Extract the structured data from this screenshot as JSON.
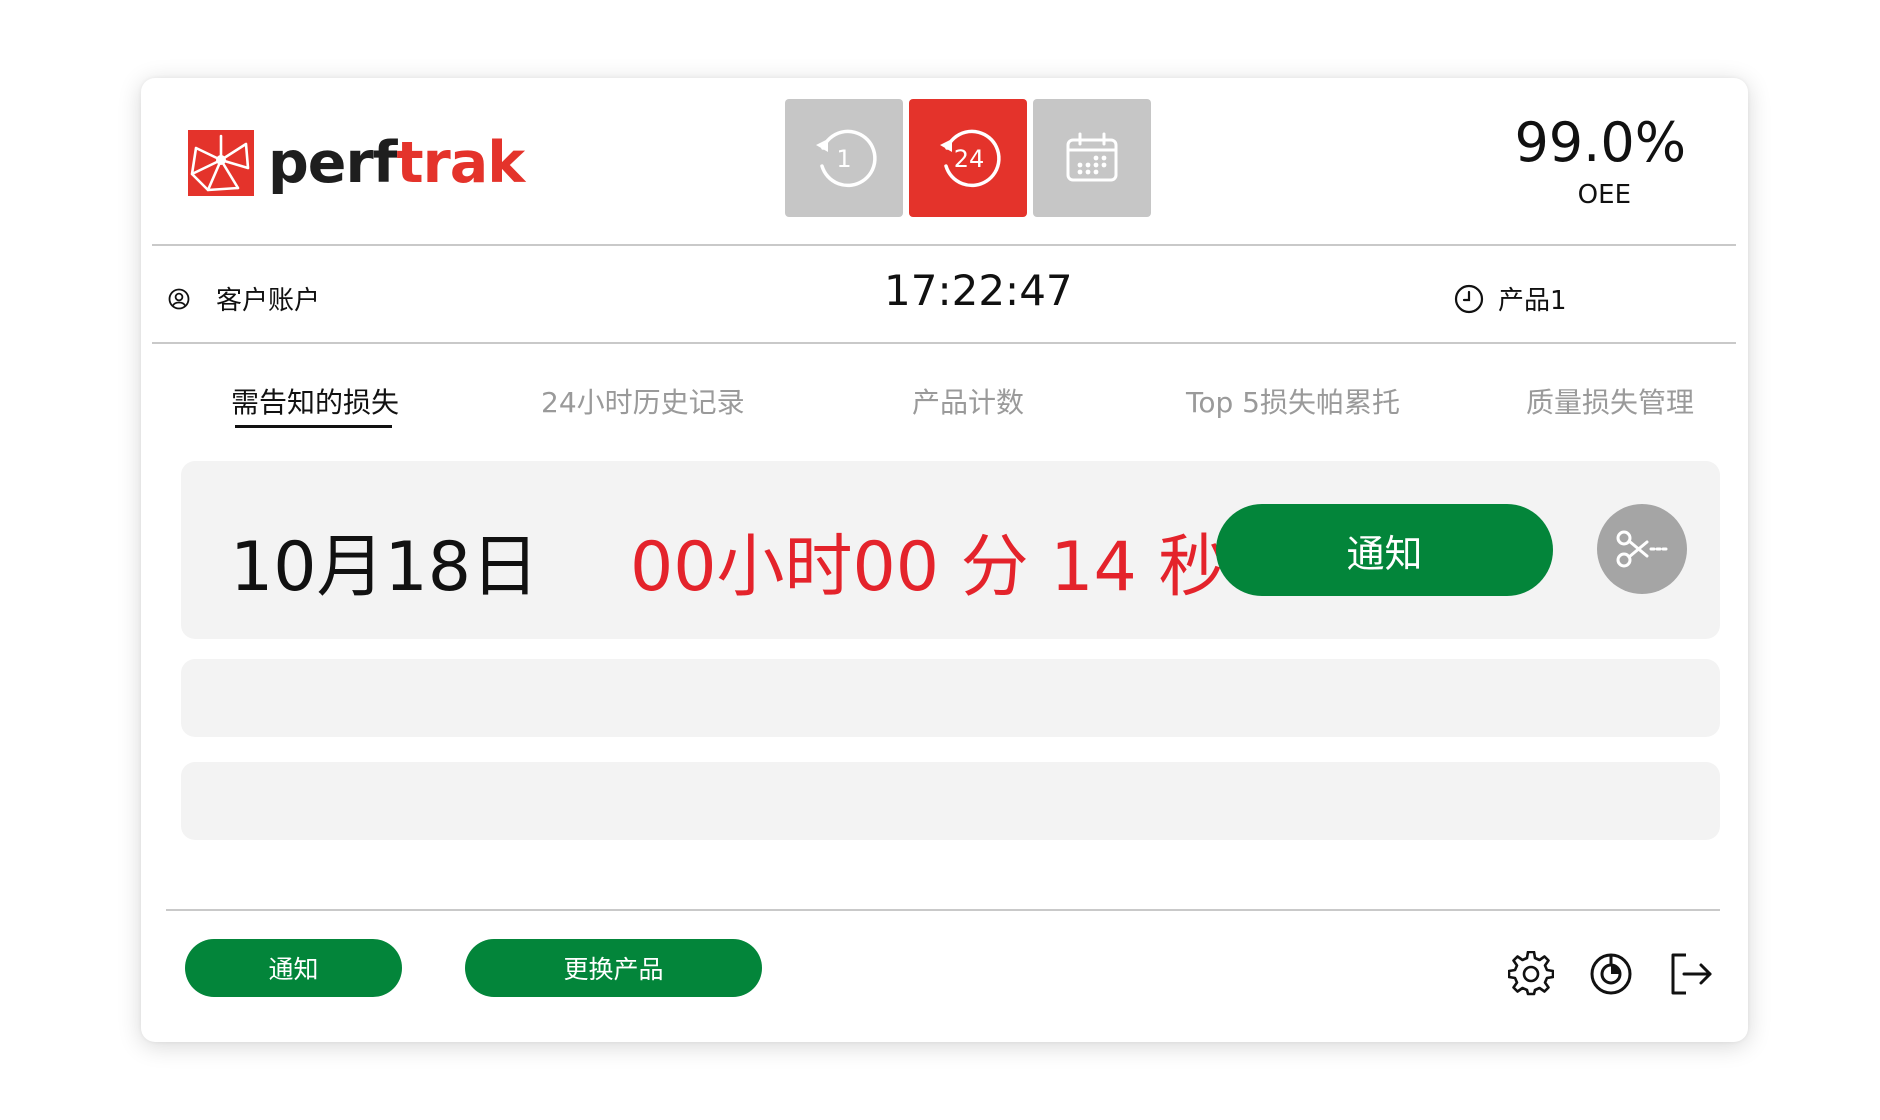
{
  "header": {
    "logo": {
      "part1": "perf",
      "part2": "trak"
    },
    "modes": [
      {
        "label": "1",
        "icon": "history-1-icon",
        "active": false
      },
      {
        "label": "24",
        "icon": "history-24-icon",
        "active": true
      },
      {
        "label": "",
        "icon": "calendar-icon",
        "active": false
      }
    ],
    "oee": {
      "value": "99.0%",
      "label": "OEE"
    }
  },
  "info_bar": {
    "account_label": "客户账户",
    "time": "17:22:47",
    "product_label": "产品1"
  },
  "tabs": [
    {
      "label": "需告知的损失",
      "active": true
    },
    {
      "label": "24小时历史记录",
      "active": false
    },
    {
      "label": "产品计数",
      "active": false
    },
    {
      "label": "Top 5损失帕累托",
      "active": false
    },
    {
      "label": "质量损失管理",
      "active": false
    }
  ],
  "loss_list": [
    {
      "date": "10月18日",
      "duration": "00小时00 分 14 秒",
      "notify_label": "通知"
    }
  ],
  "footer": {
    "notify_label": "通知",
    "change_product_label": "更换产品"
  },
  "colors": {
    "brand_red": "#e4332b",
    "duration_red": "#e4232b",
    "action_green": "#03853a",
    "inactive_gray": "#c6c6c6"
  }
}
